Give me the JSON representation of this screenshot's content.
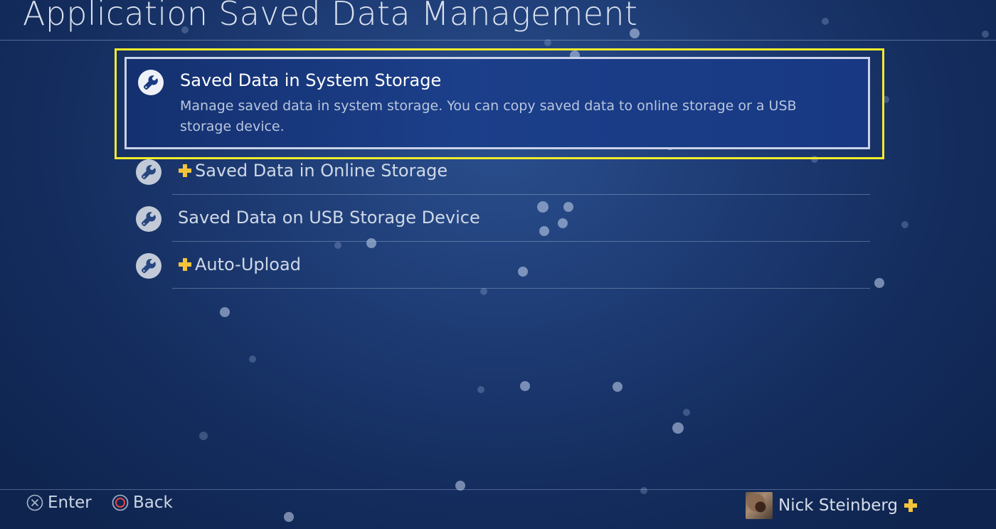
{
  "header": {
    "title": "Application Saved Data Management"
  },
  "menu": {
    "items": [
      {
        "label": "Saved Data in System Storage",
        "description": "Manage saved data in system storage. You can copy saved data to online storage or a USB storage device.",
        "icon": "wrench-icon",
        "selected": true,
        "plus_badge": false
      },
      {
        "label": "Saved Data in Online Storage",
        "icon": "wrench-icon",
        "selected": false,
        "plus_badge": true
      },
      {
        "label": "Saved Data on USB Storage Device",
        "icon": "wrench-icon",
        "selected": false,
        "plus_badge": false
      },
      {
        "label": "Auto-Upload",
        "icon": "wrench-icon",
        "selected": false,
        "plus_badge": true
      }
    ]
  },
  "footer": {
    "enter_label": "Enter",
    "back_label": "Back",
    "user_name": "Nick Steinberg"
  },
  "colors": {
    "focus_outline": "#f4ec2c",
    "plus_badge": "#f3c33b",
    "selected_bg": "#1c3f8a",
    "background": "#1d3a73"
  }
}
